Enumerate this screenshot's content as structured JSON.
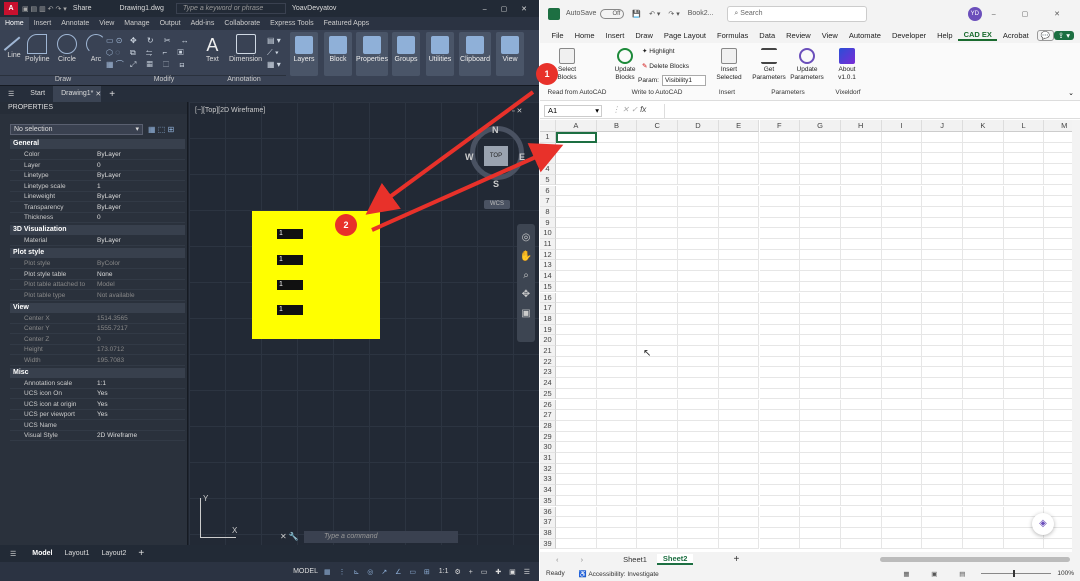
{
  "autocad": {
    "title": {
      "share": "Share",
      "filename": "Drawing1.dwg",
      "search_placeholder": "Type a keyword or phrase",
      "user": "YoavDevyatov"
    },
    "tabs": [
      "Home",
      "Insert",
      "Annotate",
      "View",
      "Manage",
      "Output",
      "Add-ins",
      "Collaborate",
      "Express Tools",
      "Featured Apps"
    ],
    "ribbon": {
      "draw_tools": [
        "Line",
        "Polyline",
        "Circle",
        "Arc"
      ],
      "text_tools": [
        "Text",
        "Dimension"
      ],
      "big_tools": [
        "Layers",
        "Block",
        "Properties",
        "Groups",
        "Utilities",
        "Clipboard",
        "View"
      ],
      "panels": [
        "Draw",
        "Modify",
        "Annotation"
      ]
    },
    "doc_tabs": [
      "Start",
      "Drawing1*"
    ],
    "properties": {
      "header": "PROPERTIES",
      "selection": "No selection",
      "categories": [
        {
          "name": "General",
          "rows": [
            {
              "k": "Color",
              "v": "ByLayer"
            },
            {
              "k": "Layer",
              "v": "0"
            },
            {
              "k": "Linetype",
              "v": "ByLayer"
            },
            {
              "k": "Linetype scale",
              "v": "1"
            },
            {
              "k": "Lineweight",
              "v": "ByLayer"
            },
            {
              "k": "Transparency",
              "v": "ByLayer"
            },
            {
              "k": "Thickness",
              "v": "0"
            }
          ]
        },
        {
          "name": "3D Visualization",
          "rows": [
            {
              "k": "Material",
              "v": "ByLayer"
            }
          ]
        },
        {
          "name": "Plot style",
          "rows": [
            {
              "k": "Plot style",
              "v": "ByColor",
              "dim": true
            },
            {
              "k": "Plot style table",
              "v": "None"
            },
            {
              "k": "Plot table attached to",
              "v": "Model",
              "dim": true
            },
            {
              "k": "Plot table type",
              "v": "Not available",
              "dim": true
            }
          ]
        },
        {
          "name": "View",
          "rows": [
            {
              "k": "Center X",
              "v": "1514.3565",
              "dim": true
            },
            {
              "k": "Center Y",
              "v": "1555.7217",
              "dim": true
            },
            {
              "k": "Center Z",
              "v": "0",
              "dim": true
            },
            {
              "k": "Height",
              "v": "173.0712",
              "dim": true
            },
            {
              "k": "Width",
              "v": "195.7083",
              "dim": true
            }
          ]
        },
        {
          "name": "Misc",
          "rows": [
            {
              "k": "Annotation scale",
              "v": "1:1"
            },
            {
              "k": "UCS icon On",
              "v": "Yes"
            },
            {
              "k": "UCS icon at origin",
              "v": "Yes"
            },
            {
              "k": "UCS per viewport",
              "v": "Yes"
            },
            {
              "k": "UCS Name",
              "v": ""
            },
            {
              "k": "Visual Style",
              "v": "2D Wireframe"
            }
          ]
        }
      ]
    },
    "viewport_label": "[−][Top][2D Wireframe]",
    "blocks": [
      "1",
      "1",
      "1",
      "1"
    ],
    "viewcube": {
      "n": "N",
      "s": "S",
      "e": "E",
      "w": "W",
      "top": "TOP",
      "wcs": "WCS"
    },
    "command_placeholder": "Type a command",
    "layouts": [
      "Model",
      "Layout1",
      "Layout2"
    ],
    "status": {
      "model": "MODEL",
      "scale": "1:1"
    }
  },
  "excel": {
    "title": {
      "autosave": "AutoSave",
      "autosave_state": "Off",
      "book": "Book2...",
      "search": "Search",
      "user_initials": "YD"
    },
    "menu": [
      "File",
      "Home",
      "Insert",
      "Draw",
      "Page Layout",
      "Formulas",
      "Data",
      "Review",
      "View",
      "Automate",
      "Developer",
      "Help",
      "CAD EX",
      "Acrobat"
    ],
    "ribbon": {
      "select_blocks": "Select Blocks",
      "update_blocks": "Update Blocks",
      "highlight": "Highlight",
      "delete_blocks": "Delete Blocks",
      "param_label": "Param:",
      "param_value": "Visibility1",
      "insert_selected": "Insert Selected",
      "get_parameters": "Get Parameters",
      "update_parameters": "Update Parameters",
      "about": "About v1.0.1",
      "groups": [
        "Read from AutoCAD",
        "Write to AutoCAD",
        "Insert",
        "Parameters",
        "Vixeldorf"
      ]
    },
    "name_box": "A1",
    "fx": "fx",
    "columns": [
      "A",
      "B",
      "C",
      "D",
      "E",
      "F",
      "G",
      "H",
      "I",
      "J",
      "K",
      "L",
      "M"
    ],
    "rows": [
      "1",
      "2",
      "3",
      "4",
      "5",
      "6",
      "7",
      "8",
      "9",
      "10",
      "11",
      "12",
      "13",
      "14",
      "15",
      "16",
      "17",
      "18",
      "19",
      "20",
      "21",
      "22",
      "23",
      "24",
      "25",
      "26",
      "27",
      "28",
      "29",
      "30",
      "31",
      "32",
      "33",
      "34",
      "35",
      "36",
      "37",
      "38",
      "39"
    ],
    "sheets": [
      "Sheet1",
      "Sheet2"
    ],
    "active_sheet": "Sheet2",
    "status": {
      "ready": "Ready",
      "accessibility": "Accessibility: Investigate",
      "zoom": "100%"
    }
  },
  "annotations": {
    "badge1": "1",
    "badge2": "2",
    "arrow_color": "#e8312a"
  }
}
